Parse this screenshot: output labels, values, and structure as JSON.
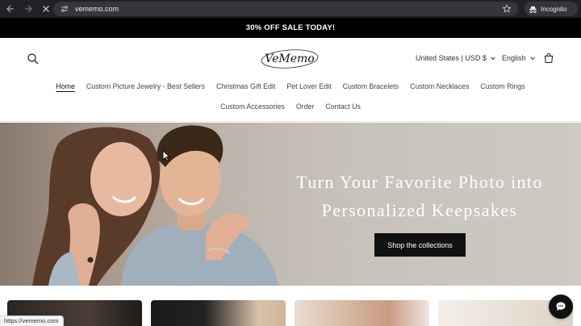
{
  "browser": {
    "url": "vememo.com",
    "incognito_label": "Incognito",
    "icons": [
      "back-arrow-icon",
      "forward-arrow-icon",
      "stop-loading-icon",
      "site-info-icon",
      "bookmark-star-icon",
      "incognito-icon"
    ]
  },
  "announcement": {
    "text": "30% OFF SALE TODAY!"
  },
  "header": {
    "logo_text": "VeMemo",
    "country_label": "United States | USD $",
    "language_label": "English",
    "icons": [
      "search-icon",
      "chevron-down-icon",
      "cart-icon"
    ]
  },
  "nav": {
    "row1": [
      {
        "label": "Home",
        "active": true
      },
      {
        "label": "Custom Picture Jewelry - Best Sellers"
      },
      {
        "label": "Christmas Gift Edit"
      },
      {
        "label": "Pet Lover Edit"
      },
      {
        "label": "Custom Bracelets"
      },
      {
        "label": "Custom Necklaces"
      },
      {
        "label": "Custom Rings"
      }
    ],
    "row2": [
      {
        "label": "Custom Accessories"
      },
      {
        "label": "Order"
      },
      {
        "label": "Contact Us"
      }
    ]
  },
  "hero": {
    "title_line1": "Turn Your Favorite Photo into",
    "title_line2": "Personalized Keepsakes",
    "cta_label": "Shop the collections"
  },
  "status_bar": {
    "text": "https://vememo.com"
  },
  "chat": {
    "icon": "chat-bubble-icon"
  },
  "colors": {
    "announcement_bg": "#000000",
    "button_bg": "#111111",
    "hero_text": "#ffffff"
  }
}
